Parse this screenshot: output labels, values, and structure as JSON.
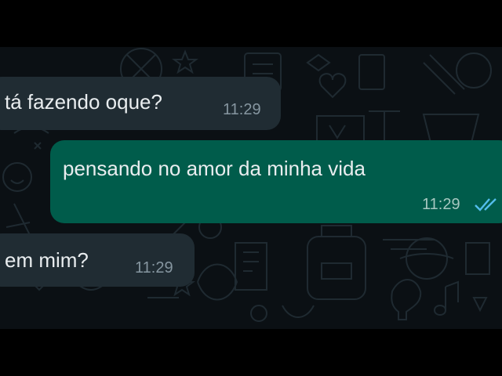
{
  "chat": {
    "background_color": "#0b1014",
    "messages": [
      {
        "direction": "incoming",
        "text": "tá fazendo oque?",
        "time": "11:29"
      },
      {
        "direction": "outgoing",
        "text": "pensando no amor da minha vida",
        "time": "11:29",
        "status": "read",
        "status_icon": "double-check-icon",
        "status_color": "#53bdeb"
      },
      {
        "direction": "incoming",
        "text": "em mim?",
        "time": "11:29"
      }
    ],
    "colors": {
      "incoming_bubble": "#202c33",
      "outgoing_bubble": "#005c4b",
      "text": "#e9edef",
      "timestamp": "#8696a0"
    }
  }
}
